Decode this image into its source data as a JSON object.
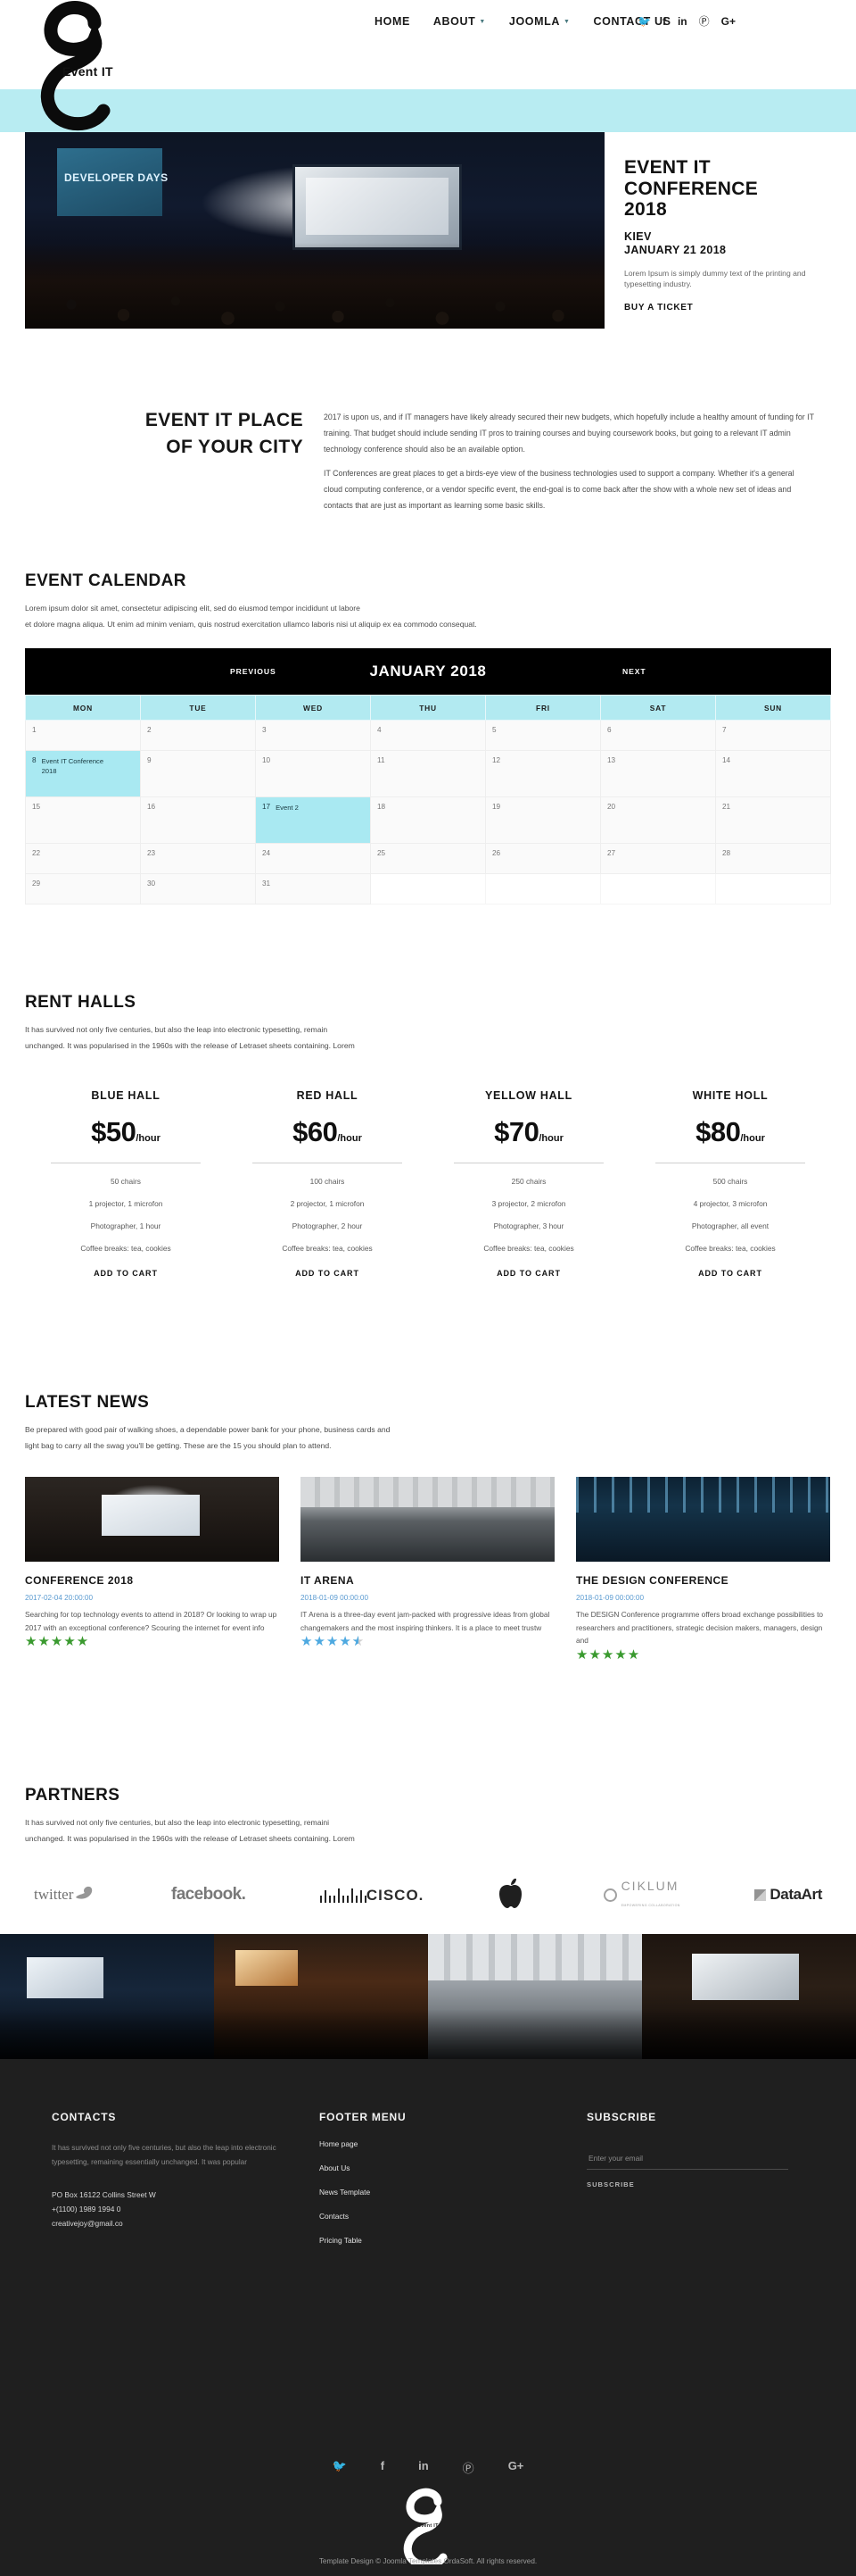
{
  "brand": {
    "name": "Event IT",
    "logo_icon": "event-it-ampersand-logo"
  },
  "nav": {
    "items": [
      {
        "label": "HOME",
        "has_dropdown": false
      },
      {
        "label": "ABOUT",
        "has_dropdown": true
      },
      {
        "label": "JOOMLA",
        "has_dropdown": true
      },
      {
        "label": "CONTACT US",
        "has_dropdown": false
      }
    ],
    "social": [
      {
        "icon": "twitter-icon",
        "glyph": "🐦"
      },
      {
        "icon": "facebook-icon",
        "glyph": "f"
      },
      {
        "icon": "linkedin-icon",
        "glyph": "in"
      },
      {
        "icon": "pinterest-icon",
        "glyph": "Ⓟ"
      },
      {
        "icon": "google-plus-icon",
        "glyph": "G+"
      }
    ]
  },
  "hero": {
    "banner_text": "DEVELOPER DAYS",
    "title": "EVENT IT\nCONFERENCE\n2018",
    "city": "KIEV",
    "date": "JANUARY 21 2018",
    "description": "Lorem Ipsum is simply dummy text of the printing and typesetting industry.",
    "cta": "BUY A TICKET"
  },
  "intro": {
    "heading": "EVENT IT PLACE OF YOUR CITY",
    "paragraphs": [
      "2017 is upon us, and if IT managers have likely already secured their new budgets, which hopefully include a healthy amount of funding for IT training. That budget should include sending IT pros to training courses and buying coursework books, but going to a relevant IT admin technology conference should also be an available option.",
      "IT Conferences are great places to get a birds-eye view of the business technologies used to support a company. Whether it's a general cloud computing conference, or a vendor specific event, the end-goal is to come back after the show with a whole new set of ideas and contacts that are just as important as learning some basic skills."
    ]
  },
  "calendar": {
    "title": "EVENT CALENDAR",
    "lead": "Lorem ipsum dolor sit amet, consectetur adipiscing elit, sed do eiusmod tempor incididunt ut labore\net dolore magna aliqua. Ut enim ad minim veniam, quis nostrud exercitation ullamco laboris nisi ut aliquip ex ea commodo consequat.",
    "prev_label": "PREVIOUS",
    "next_label": "NEXT",
    "month_label": "JANUARY 2018",
    "weekdays": [
      "MON",
      "TUE",
      "WED",
      "THU",
      "FRI",
      "SAT",
      "SUN"
    ],
    "weeks": [
      [
        {
          "day": "1"
        },
        {
          "day": "2"
        },
        {
          "day": "3"
        },
        {
          "day": "4"
        },
        {
          "day": "5"
        },
        {
          "day": "6"
        },
        {
          "day": "7"
        }
      ],
      [
        {
          "day": "8",
          "event": "Event IT Conference 2018"
        },
        {
          "day": "9"
        },
        {
          "day": "10"
        },
        {
          "day": "11"
        },
        {
          "day": "12"
        },
        {
          "day": "13"
        },
        {
          "day": "14"
        }
      ],
      [
        {
          "day": "15"
        },
        {
          "day": "16"
        },
        {
          "day": "17",
          "event": "Event 2"
        },
        {
          "day": "18"
        },
        {
          "day": "19"
        },
        {
          "day": "20"
        },
        {
          "day": "21"
        }
      ],
      [
        {
          "day": "22"
        },
        {
          "day": "23"
        },
        {
          "day": "24"
        },
        {
          "day": "25"
        },
        {
          "day": "26"
        },
        {
          "day": "27"
        },
        {
          "day": "28"
        }
      ],
      [
        {
          "day": "29"
        },
        {
          "day": "30"
        },
        {
          "day": "31"
        },
        {
          "day": ""
        },
        {
          "day": ""
        },
        {
          "day": ""
        },
        {
          "day": ""
        }
      ]
    ]
  },
  "rent": {
    "title": "RENT HALLS",
    "lead": "It has survived not only five centuries, but also the leap into electronic typesetting, remain\nunchanged. It was popularised in the 1960s with the release of Letraset sheets containing. Lorem",
    "plans": [
      {
        "name": "BLUE HALL",
        "price": "$50",
        "period": "/hour",
        "features": [
          "50 chairs",
          "1 projector, 1 microfon",
          "Photographer, 1 hour",
          "Coffee breaks: tea, cookies"
        ],
        "cta": "ADD TO CART"
      },
      {
        "name": "RED HALL",
        "price": "$60",
        "period": "/hour",
        "features": [
          "100 chairs",
          "2 projector, 1 microfon",
          "Photographer, 2 hour",
          "Coffee breaks: tea, cookies"
        ],
        "cta": "ADD TO CART"
      },
      {
        "name": "YELLOW HALL",
        "price": "$70",
        "period": "/hour",
        "features": [
          "250 chairs",
          "3 projector, 2 microfon",
          "Photographer, 3 hour",
          "Coffee breaks: tea, cookies"
        ],
        "cta": "ADD TO CART"
      },
      {
        "name": "WHITE HOLL",
        "price": "$80",
        "period": "/hour",
        "features": [
          "500 chairs",
          "4 projector, 3 microfon",
          "Photographer, all event",
          "Coffee breaks: tea, cookies"
        ],
        "cta": "ADD TO CART"
      }
    ]
  },
  "news": {
    "title": "LATEST NEWS",
    "lead": "Be prepared with good pair of walking shoes, a dependable power bank for your phone, business cards and\nlight bag to carry all the swag you'll be getting. These are the 15 you should plan to attend.",
    "items": [
      {
        "title": "CONFERENCE 2018",
        "date": "2017-02-04 20:00:00",
        "excerpt": "Searching for top technology events to attend in 2018? Or looking to wrap up 2017 with an exceptional conference? Scouring the internet for event info",
        "rating": 5,
        "rating_color": "#3a9a2f"
      },
      {
        "title": "IT ARENA",
        "date": "2018-01-09 00:00:00",
        "excerpt": "IT Arena is a three-day event jam-packed with progressive ideas from global changemakers and the most inspiring thinkers. It is a place to meet trustw",
        "rating": 4.5,
        "rating_color": "#4ea9e0"
      },
      {
        "title": "THE DESIGN CONFERENCE",
        "date": "2018-01-09 00:00:00",
        "excerpt": "The DESIGN Conference programme offers broad exchange possibilities to researchers and practitioners, strategic decision makers, managers, design and",
        "rating": 5,
        "rating_color": "#3a9a2f"
      }
    ]
  },
  "partners": {
    "title": "PARTNERS",
    "lead": "It has survived not only five centuries, but also the leap into electronic typesetting, remaini\nunchanged. It was popularised in the 1960s with the release of Letraset sheets containing. Lorem",
    "logos": [
      {
        "name": "twitter-logo",
        "label": "twitter"
      },
      {
        "name": "facebook-logo",
        "label": "facebook."
      },
      {
        "name": "cisco-logo",
        "label": "CISCO."
      },
      {
        "name": "apple-logo",
        "label": ""
      },
      {
        "name": "ciklum-logo",
        "label": "CIKLUM",
        "sub": "EMPOWERING COLLABORATION"
      },
      {
        "name": "dataart-logo",
        "label": "DataArt"
      }
    ]
  },
  "footer": {
    "contacts": {
      "heading": "CONTACTS",
      "text": "It has survived not only five centuries, but also the leap into electronic typesetting, remaining essentially unchanged. It was popular",
      "address": "PO Box 16122 Collins Street W",
      "phone": "+(1100) 1989 1994 0",
      "email": "creativejoy@gmail.co"
    },
    "menu": {
      "heading": "FOOTER MENU",
      "items": [
        "Home page",
        "About Us",
        "News Template",
        "Contacts",
        "Pricing Table"
      ]
    },
    "subscribe": {
      "heading": "SUBSCRIBE",
      "placeholder": "Enter your email",
      "value": "",
      "button": "SUBSCRIBE"
    },
    "social": [
      {
        "icon": "twitter-icon",
        "glyph": "🐦"
      },
      {
        "icon": "facebook-icon",
        "glyph": "f"
      },
      {
        "icon": "linkedin-icon",
        "glyph": "in"
      },
      {
        "icon": "pinterest-icon",
        "glyph": "Ⓟ"
      },
      {
        "icon": "google-plus-icon",
        "glyph": "G+"
      }
    ],
    "logo_label": "Event IT",
    "copyright": "Template Design © Joomla Templates OrdaSoft. All rights reserved."
  },
  "colors": {
    "accent": "#b8ecf2",
    "event_cell": "#a9e9f2",
    "footer_bg": "#1f1f1f",
    "link_blue": "#5b9bd1"
  }
}
